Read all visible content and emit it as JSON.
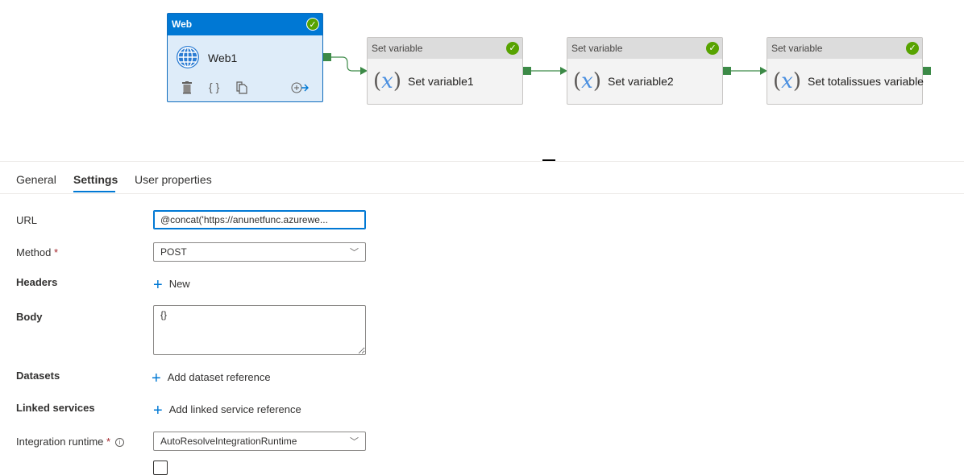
{
  "pipeline": {
    "web_activity": {
      "type": "Web",
      "name": "Web1",
      "status": "success",
      "actions": [
        "delete-icon",
        "code-icon",
        "copy-icon",
        "add-output-icon"
      ]
    },
    "set_variable_activities": [
      {
        "type": "Set variable",
        "name": "Set variable1",
        "status": "success"
      },
      {
        "type": "Set variable",
        "name": "Set variable2",
        "status": "success"
      },
      {
        "type": "Set variable",
        "name": "Set totalissues variable",
        "status": "success"
      }
    ],
    "colors": {
      "accent": "#0078d4",
      "success": "#57a300",
      "connector": "#3c8a47"
    }
  },
  "tabs": [
    {
      "label": "General",
      "active": false
    },
    {
      "label": "Settings",
      "active": true
    },
    {
      "label": "User properties",
      "active": false
    }
  ],
  "settings": {
    "url": {
      "label": "URL",
      "value": "@concat('https://anunetfunc.azurewe..."
    },
    "method": {
      "label": "Method",
      "required": "*",
      "value": "POST"
    },
    "headers": {
      "label": "Headers",
      "action": "New"
    },
    "body": {
      "label": "Body",
      "value": "{}"
    },
    "datasets": {
      "label": "Datasets",
      "action": "Add dataset reference"
    },
    "linked_services": {
      "label": "Linked services",
      "action": "Add linked service reference"
    },
    "integration_runtime": {
      "label": "Integration runtime",
      "required": "*",
      "value": "AutoResolveIntegrationRuntime"
    }
  },
  "glyphs": {
    "check": "✓",
    "chevron": "﹀",
    "plus": "+",
    "info": "i",
    "braces": "{ }"
  }
}
